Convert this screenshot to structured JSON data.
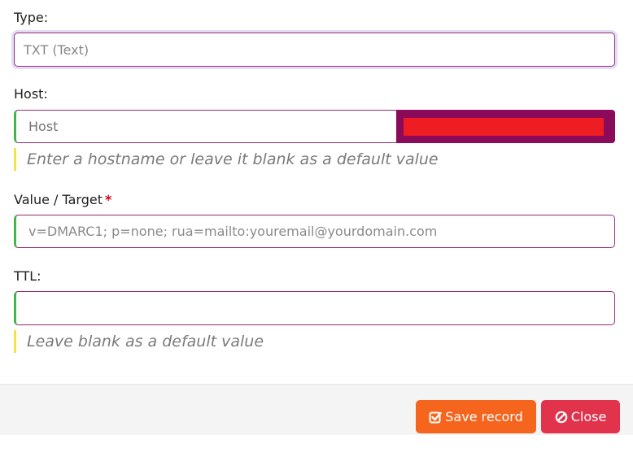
{
  "type": {
    "label": "Type:",
    "value": "TXT (Text)"
  },
  "host": {
    "label": "Host:",
    "placeholder": "Host",
    "hint": "Enter a hostname or leave it blank as a default value",
    "suffix_redacted": true
  },
  "value": {
    "label": "Value / Target",
    "required_mark": "*",
    "value": "v=DMARC1; p=none; rua=mailto:youremail@yourdomain.com"
  },
  "ttl": {
    "label": "TTL:",
    "value": "",
    "hint": "Leave blank as a default value"
  },
  "footer": {
    "save_label": "Save record",
    "close_label": "Close"
  },
  "colors": {
    "save_button": "#f5651e",
    "close_button": "#e2334d",
    "field_border": "#9b2a74",
    "valid_accent": "#45b54a",
    "hint_accent": "#f2e34a",
    "host_suffix_bg": "#8c0a5a",
    "redaction": "#ee1d23"
  },
  "icons": {
    "save": "check-square-icon",
    "close": "ban-icon"
  }
}
